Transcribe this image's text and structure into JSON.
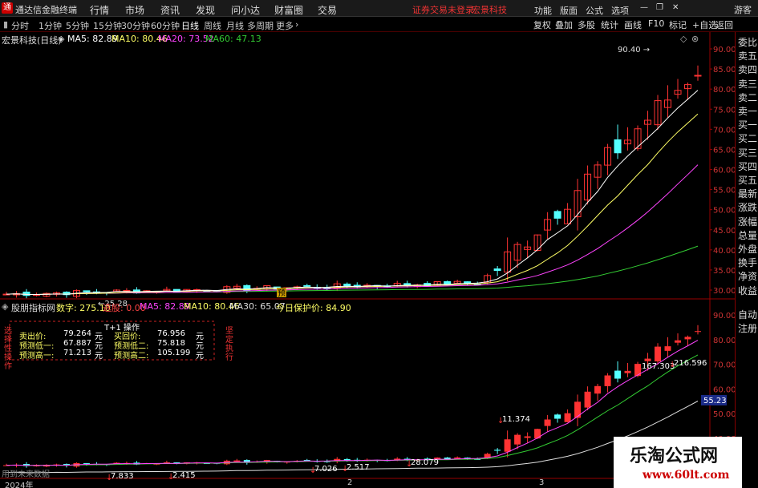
{
  "app": {
    "logo_glyph": "通",
    "title": "通达信金融终端"
  },
  "menu": [
    "行情",
    "市场",
    "资讯",
    "发现",
    "问小达",
    "财富圈",
    "交易"
  ],
  "notices": [
    "证券交易未登录",
    "宏景科技"
  ],
  "top_right": [
    "功能",
    "版面",
    "公式",
    "选项"
  ],
  "guest": "游客",
  "periods": [
    "分时",
    "1分钟",
    "5分钟",
    "15分钟",
    "30分钟",
    "60分钟",
    "日线",
    "周线",
    "月线",
    "多周期",
    "更多"
  ],
  "active_period": "日线",
  "toolbar_right": [
    "复权",
    "叠加",
    "多股",
    "统计",
    "画线",
    "F10",
    "标记",
    "+自选",
    "返回"
  ],
  "main_info": {
    "stock": "宏景科技(日线)",
    "ma5": "MA5: 82.89",
    "ma10": "MA10: 80.46",
    "ma20": "MA20: 73.52",
    "ma60": "MA60: 47.13"
  },
  "main_axis": [
    "90.00",
    "85.00",
    "80.00",
    "75.00",
    "70.00",
    "65.00",
    "60.00",
    "55.00",
    "50.00",
    "45.00",
    "40.00",
    "35.00",
    "30.00"
  ],
  "main_annotations": {
    "high": "90.40",
    "low": "25.28",
    "marker": "预"
  },
  "right_panel": [
    "委比",
    "卖五",
    "卖四",
    "卖三",
    "卖二",
    "卖一",
    "买一",
    "买二",
    "买三",
    "买四",
    "买五",
    "最新",
    "涨跌",
    "涨幅",
    "总量",
    "外盘",
    "换手",
    "净资",
    "收益"
  ],
  "right_panel_lower": [
    "自动",
    "注册"
  ],
  "indicator_info": {
    "name": "股朋指标网",
    "num": "数字: 275.10",
    "sel": "选股: 0.00",
    "ma5": "MA5: 82.89",
    "ma10": "MA10: 80.46",
    "ma30": "MA30: 65.07",
    "protect": "今日保护价: 84.90"
  },
  "tpanel": {
    "title": "T+1 操作",
    "rows": [
      [
        "卖出价:",
        "79.264",
        "元",
        "买回价:",
        "76.956",
        "元"
      ],
      [
        "预测低一:",
        "67.887",
        "元",
        "预测低二:",
        "75.818",
        "元"
      ],
      [
        "预测高一:",
        "71.213",
        "元",
        "预测高二:",
        "105.199",
        "元"
      ]
    ],
    "left_vertical": "选择性操作",
    "right_vertical": "坚定执行"
  },
  "ind_axis": [
    "90.00",
    "80.00",
    "70.00",
    "60.00",
    "55.23",
    "50.00",
    "40.00"
  ],
  "ind_annotations": [
    "167.303",
    "216.596",
    "11.374",
    "28.079",
    "7.026",
    "2.517",
    "7.833",
    "2.415"
  ],
  "bottom": {
    "warning": "用到未来数据",
    "year": "2024年",
    "m2": "2",
    "m3": "3"
  },
  "watermark": {
    "line1": "乐淘公式网",
    "line2": "www.60lt.com"
  },
  "colors": {
    "up": "#ff3333",
    "down": "#54ffff",
    "ma5": "#ffffff",
    "ma10": "#ffff66",
    "ma20": "#ff44ff",
    "ma60": "#33cc33",
    "axis": "#990000"
  }
}
